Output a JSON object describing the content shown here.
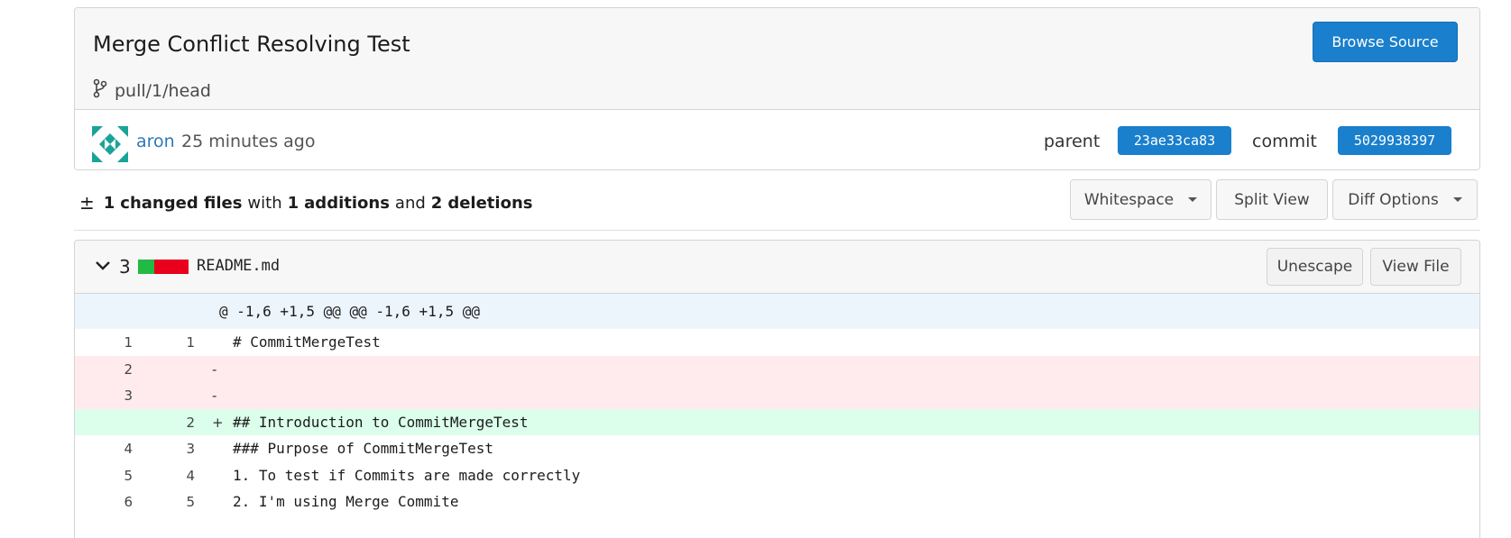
{
  "commit": {
    "title": "Merge Conflict Resolving Test",
    "branch": "pull/1/head",
    "browse_label": "Browse Source",
    "author": "aron",
    "time": "25 minutes ago",
    "parent_label": "parent",
    "parent_sha": "23ae33ca83",
    "commit_label": "commit",
    "commit_sha": "5029938397"
  },
  "stats": {
    "changed_count": "1",
    "changed_label": "changed files",
    "with": "with",
    "additions_count": "1",
    "additions_label": "additions",
    "and": "and",
    "deletions_count": "2",
    "deletions_label": "deletions"
  },
  "toolbar": {
    "whitespace": "Whitespace",
    "split_view": "Split View",
    "diff_options": "Diff Options"
  },
  "file": {
    "count": "3",
    "name": "README.md",
    "unescape": "Unescape",
    "view_file": "View File",
    "additions_bar": 1,
    "deletions_bar": 2,
    "section_header": "@ -1,6 +1,5 @@ @@ -1,6 +1,5 @@",
    "lines": [
      {
        "type": "ctx",
        "old": "1",
        "new": "1",
        "sign": "",
        "code": "# CommitMergeTest"
      },
      {
        "type": "del",
        "old": "2",
        "new": "",
        "sign": "-",
        "code": ""
      },
      {
        "type": "del",
        "old": "3",
        "new": "",
        "sign": "-",
        "code": ""
      },
      {
        "type": "add",
        "old": "",
        "new": "2",
        "sign": "+",
        "code": "## Introduction to CommitMergeTest"
      },
      {
        "type": "ctx",
        "old": "4",
        "new": "3",
        "sign": "",
        "code": "### Purpose of CommitMergeTest"
      },
      {
        "type": "ctx",
        "old": "5",
        "new": "4",
        "sign": "",
        "code": "1. To test if Commits are made correctly"
      },
      {
        "type": "ctx",
        "old": "6",
        "new": "5",
        "sign": "",
        "code": "2. I'm using Merge Commite"
      }
    ]
  },
  "colors": {
    "primary": "#1a7fcc",
    "add_bg": "#dbffea",
    "del_bg": "#ffebee",
    "section_bg": "#edf5fc"
  }
}
